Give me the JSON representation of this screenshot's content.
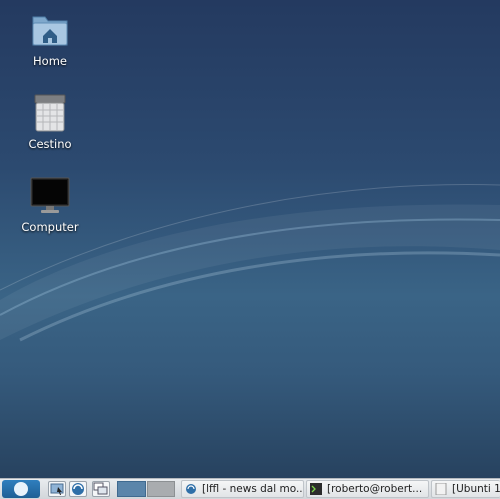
{
  "desktop": {
    "icons": [
      {
        "label": "Home",
        "icon": "home-folder-icon"
      },
      {
        "label": "Cestino",
        "icon": "trash-icon"
      },
      {
        "label": "Computer",
        "icon": "computer-monitor-icon"
      }
    ]
  },
  "taskbar": {
    "launchers": [
      "show-desktop-icon",
      "browser-icon",
      "window-switcher-icon"
    ],
    "workspaces": 2,
    "tasks": [
      {
        "label": "[lffl - news dal mo...",
        "icon": "browser-icon"
      },
      {
        "label": "[roberto@robert...",
        "icon": "terminal-icon"
      },
      {
        "label": "[Ubunti 1",
        "icon": "document-icon"
      }
    ]
  },
  "colors": {
    "desktop_top": "#243a60",
    "desktop_mid": "#3a6486",
    "panel": "#dfe2e5",
    "menu_button": "#2f7fbe"
  }
}
